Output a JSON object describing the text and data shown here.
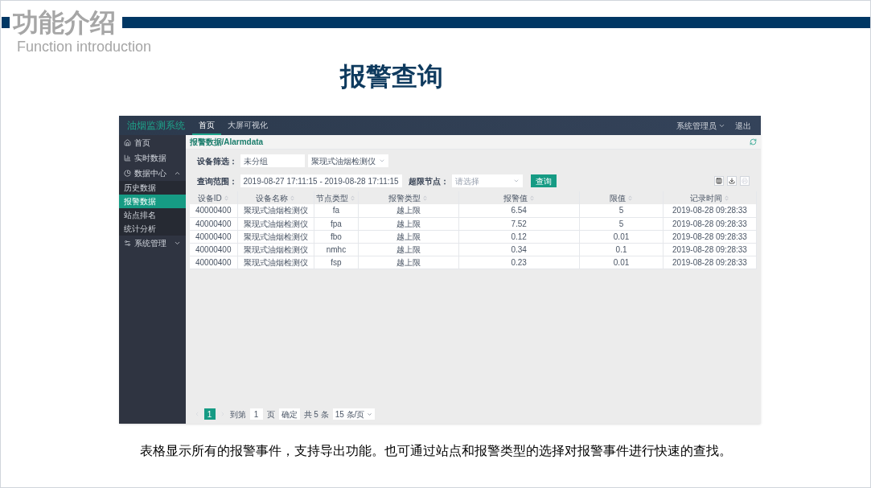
{
  "slide": {
    "title": "功能介绍",
    "subtitle": "Function introduction",
    "heading": "报警查询",
    "caption": "表格显示所有的报警事件，支持导出功能。也可通过站点和报警类型的选择对报警事件进行快速的查找。"
  },
  "app": {
    "logo": "油烟监测系统",
    "nav_tabs": [
      {
        "label": "首页",
        "selected": true
      },
      {
        "label": "大屏可视化",
        "selected": false
      }
    ],
    "user_menu": "系统管理员",
    "logout": "退出",
    "sidebar": [
      {
        "kind": "link",
        "label": "首页",
        "selected": false
      },
      {
        "kind": "link",
        "label": "实时数据",
        "selected": false
      },
      {
        "kind": "group",
        "label": "数据中心",
        "selected": false,
        "expanded": true,
        "children": [
          {
            "label": "历史数据",
            "selected": false
          },
          {
            "label": "报警数据",
            "selected": true
          },
          {
            "label": "站点排名",
            "selected": false
          },
          {
            "label": "统计分析",
            "selected": false
          }
        ]
      },
      {
        "kind": "group",
        "label": "系统管理",
        "selected": false,
        "expanded": false
      }
    ],
    "breadcrumb": "报警数据/Alarmdata",
    "filters": {
      "device_label": "设备筛选：",
      "group_value": "未分组",
      "device_value": "聚现式油烟检测仪",
      "range_label": "查询范围：",
      "range_value": "2019-08-27 17:11:15 - 2019-08-28 17:11:15",
      "node_label": "超限节点：",
      "node_placeholder": "请选择",
      "search_button": "查询"
    },
    "table": {
      "columns": [
        "设备ID",
        "设备名称",
        "节点类型",
        "报警类型",
        "报警值",
        "限值",
        "记录时间"
      ],
      "rows": [
        [
          "40000400",
          "聚现式油烟检测仪",
          "fa",
          "越上限",
          "6.54",
          "5",
          "2019-08-28 09:28:33"
        ],
        [
          "40000400",
          "聚现式油烟检测仪",
          "fpa",
          "越上限",
          "7.52",
          "5",
          "2019-08-28 09:28:33"
        ],
        [
          "40000400",
          "聚现式油烟检测仪",
          "fbo",
          "越上限",
          "0.12",
          "0.01",
          "2019-08-28 09:28:33"
        ],
        [
          "40000400",
          "聚现式油烟检测仪",
          "nmhc",
          "越上限",
          "0.34",
          "0.1",
          "2019-08-28 09:28:33"
        ],
        [
          "40000400",
          "聚现式油烟检测仪",
          "fsp",
          "越上限",
          "0.23",
          "0.01",
          "2019-08-28 09:28:33"
        ]
      ]
    },
    "pagination": {
      "pages": [
        {
          "label": "1",
          "selected": true
        }
      ],
      "goto_label": "到第",
      "goto_value": "1",
      "page_unit": "页",
      "confirm": "确定",
      "total": "共 5 条",
      "page_size": "15 条/页"
    }
  }
}
